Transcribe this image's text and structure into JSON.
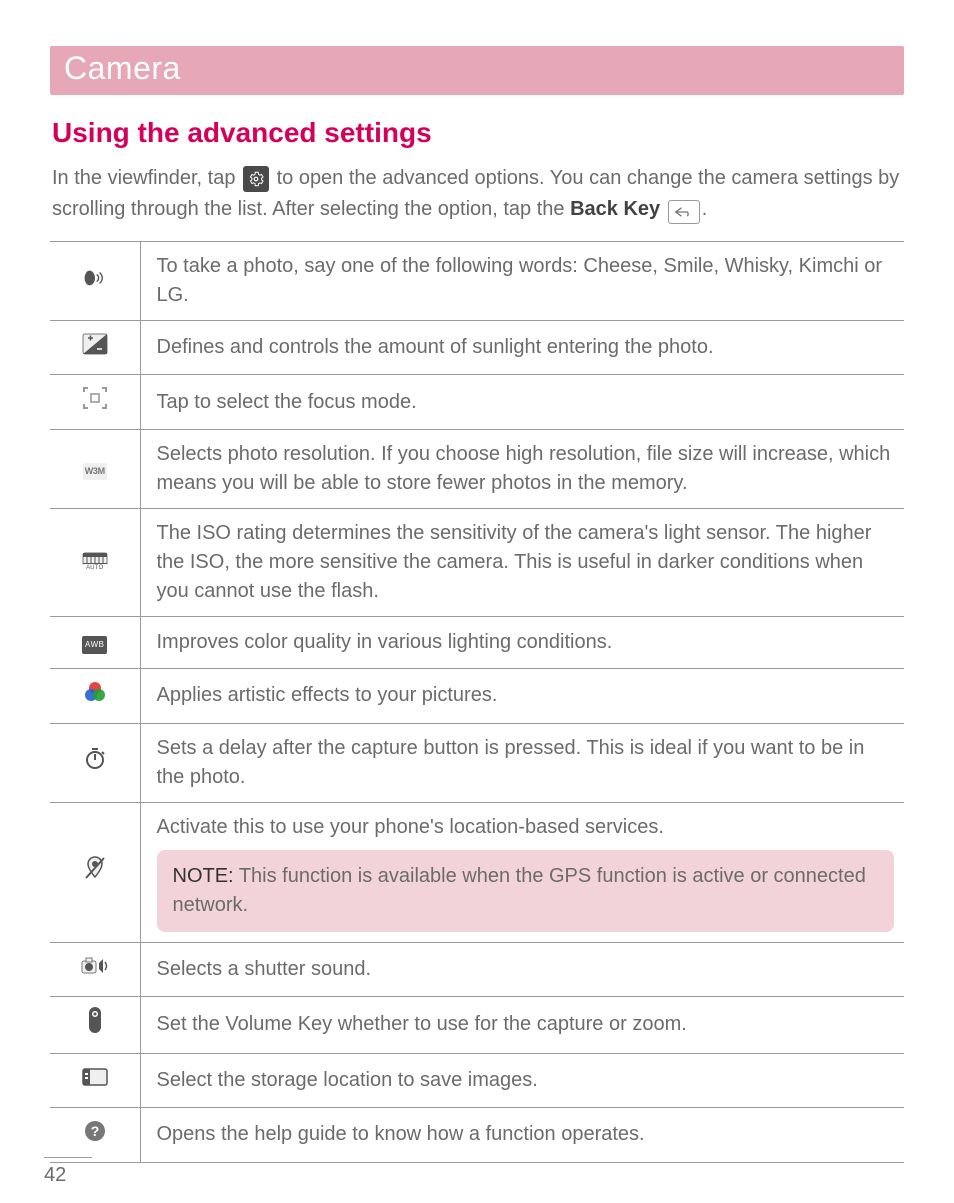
{
  "header": {
    "title": "Camera"
  },
  "section": {
    "heading": "Using the advanced settings",
    "intro_part1": "In the viewfinder, tap ",
    "intro_part2": " to open the advanced options. You can change the camera settings by scrolling through the list. After selecting the option, tap the ",
    "back_key_label": "Back Key",
    "intro_period": "."
  },
  "icons": {
    "gear": "gear-icon",
    "back": "back-key-icon",
    "voice": "voice-shutter-icon",
    "exposure": "exposure-icon",
    "focus": "focus-mode-icon",
    "resolution": "resolution-icon",
    "resolution_label": "W3M",
    "iso": "iso-icon",
    "iso_label": "AUTO",
    "awb": "white-balance-icon",
    "awb_label": "AWB",
    "color_effect": "color-effect-icon",
    "timer": "timer-icon",
    "geotag": "geotag-icon",
    "shutter_sound": "shutter-sound-icon",
    "volume_key": "volume-key-icon",
    "storage": "storage-icon",
    "help": "help-icon"
  },
  "rows": [
    {
      "desc": "To take a photo, say one of the following words: Cheese, Smile, Whisky, Kimchi or LG."
    },
    {
      "desc": "Defines and controls the amount of sunlight entering the photo."
    },
    {
      "desc": "Tap to select the focus mode."
    },
    {
      "desc": "Selects photo resolution. If you choose high resolution, file size will increase, which means you will be able to store fewer photos in the memory."
    },
    {
      "desc": "The ISO rating determines the sensitivity of the camera's light sensor. The higher the ISO, the more sensitive the camera. This is useful in darker conditions when you cannot use the flash."
    },
    {
      "desc": "Improves color quality in various lighting conditions."
    },
    {
      "desc": "Applies artistic effects to your pictures."
    },
    {
      "desc": "Sets a delay after the capture button is pressed. This is ideal if you want to be in the photo."
    },
    {
      "desc": "Activate this to use your phone's location-based services.",
      "note_label": "NOTE:",
      "note_text": " This function is available when the GPS function is active or connected network."
    },
    {
      "desc": "Selects a shutter sound."
    },
    {
      "desc": "Set the Volume Key whether to use for the capture or zoom."
    },
    {
      "desc": "Select the storage location to save images."
    },
    {
      "desc": "Opens the help guide to know how a function operates."
    }
  ],
  "page_number": "42"
}
